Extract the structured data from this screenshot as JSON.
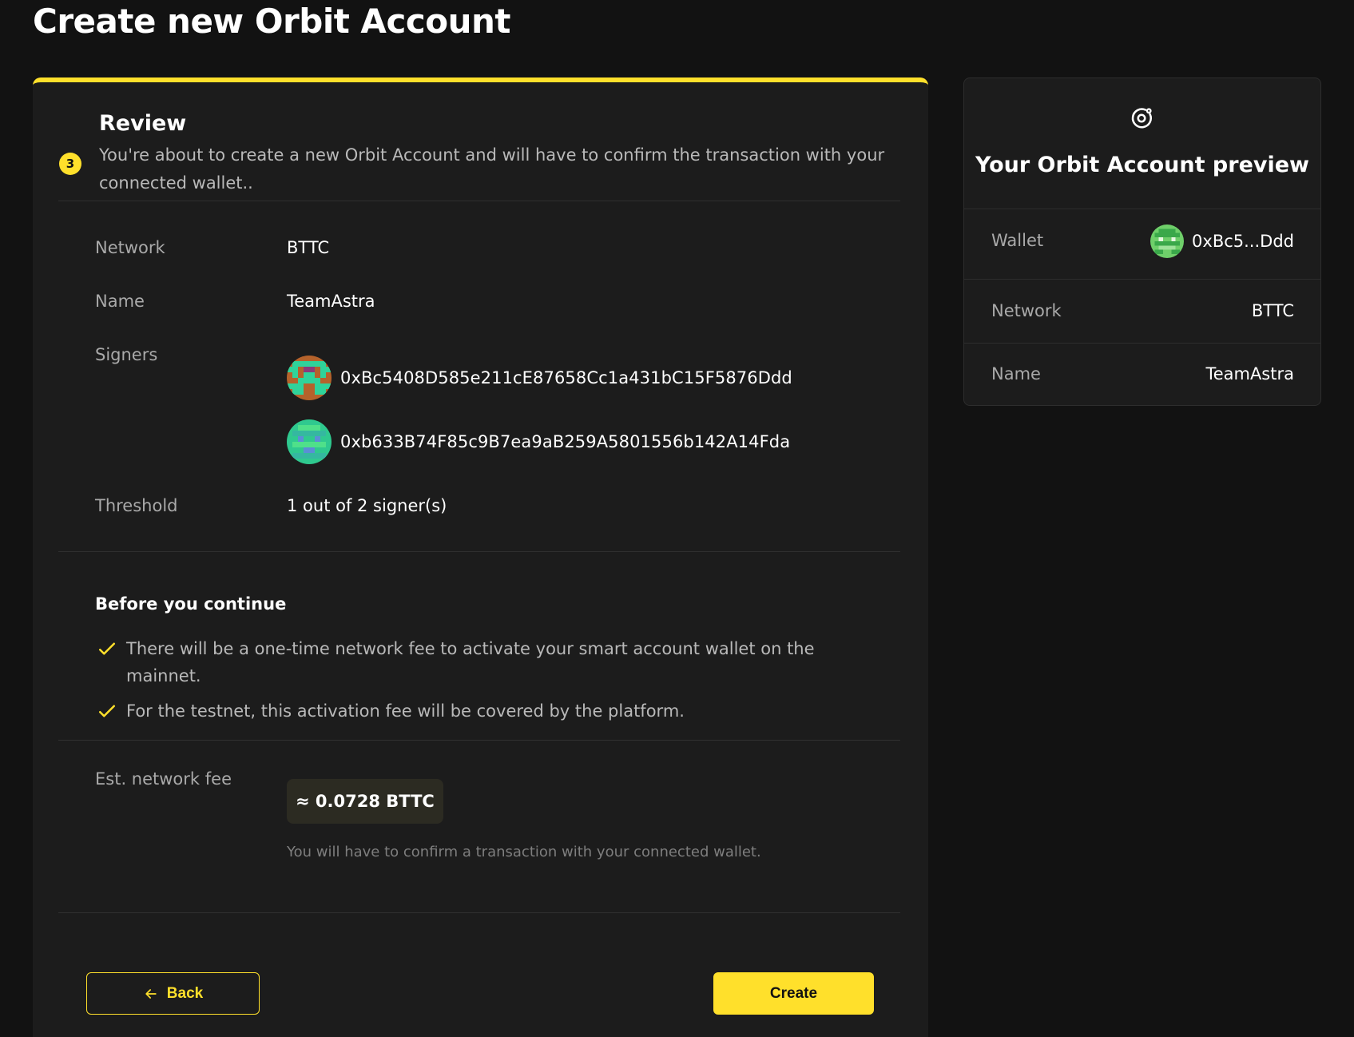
{
  "page": {
    "title": "Create new Orbit Account"
  },
  "step": {
    "number": "3",
    "title": "Review",
    "description": "You're about to create a new Orbit Account and will have to confirm the transaction with your connected wallet.."
  },
  "review": {
    "network_label": "Network",
    "network_value": "BTTC",
    "name_label": "Name",
    "name_value": "TeamAstra",
    "signers_label": "Signers",
    "signers": [
      "0xBc5408D585e211cE87658Cc1a431bC15F5876Ddd",
      "0xb633B74F85c9B7ea9aB259A5801556b142A14Fda"
    ],
    "threshold_label": "Threshold",
    "threshold_value": "1 out of 2 signer(s)"
  },
  "notice": {
    "title": "Before you continue",
    "items": [
      "There will be a one-time network fee to activate your smart account wallet on the mainnet.",
      "For the testnet, this activation fee will be covered by the platform."
    ]
  },
  "fee": {
    "label": "Est. network fee",
    "value": "≈ 0.0728 BTTC",
    "note": "You will have to confirm a transaction with your connected wallet."
  },
  "actions": {
    "back_label": "Back",
    "create_label": "Create"
  },
  "preview": {
    "title": "Your Orbit Account preview",
    "wallet_label": "Wallet",
    "wallet_value": "0xBc5...Ddd",
    "network_label": "Network",
    "network_value": "BTTC",
    "name_label": "Name",
    "name_value": "TeamAstra"
  },
  "icons": {
    "check": "check-icon",
    "back_arrow": "arrow-left-icon",
    "orbit": "orbit-icon"
  },
  "colors": {
    "accent": "#ffe02b",
    "background": "#121212",
    "card": "#1c1c1c"
  }
}
